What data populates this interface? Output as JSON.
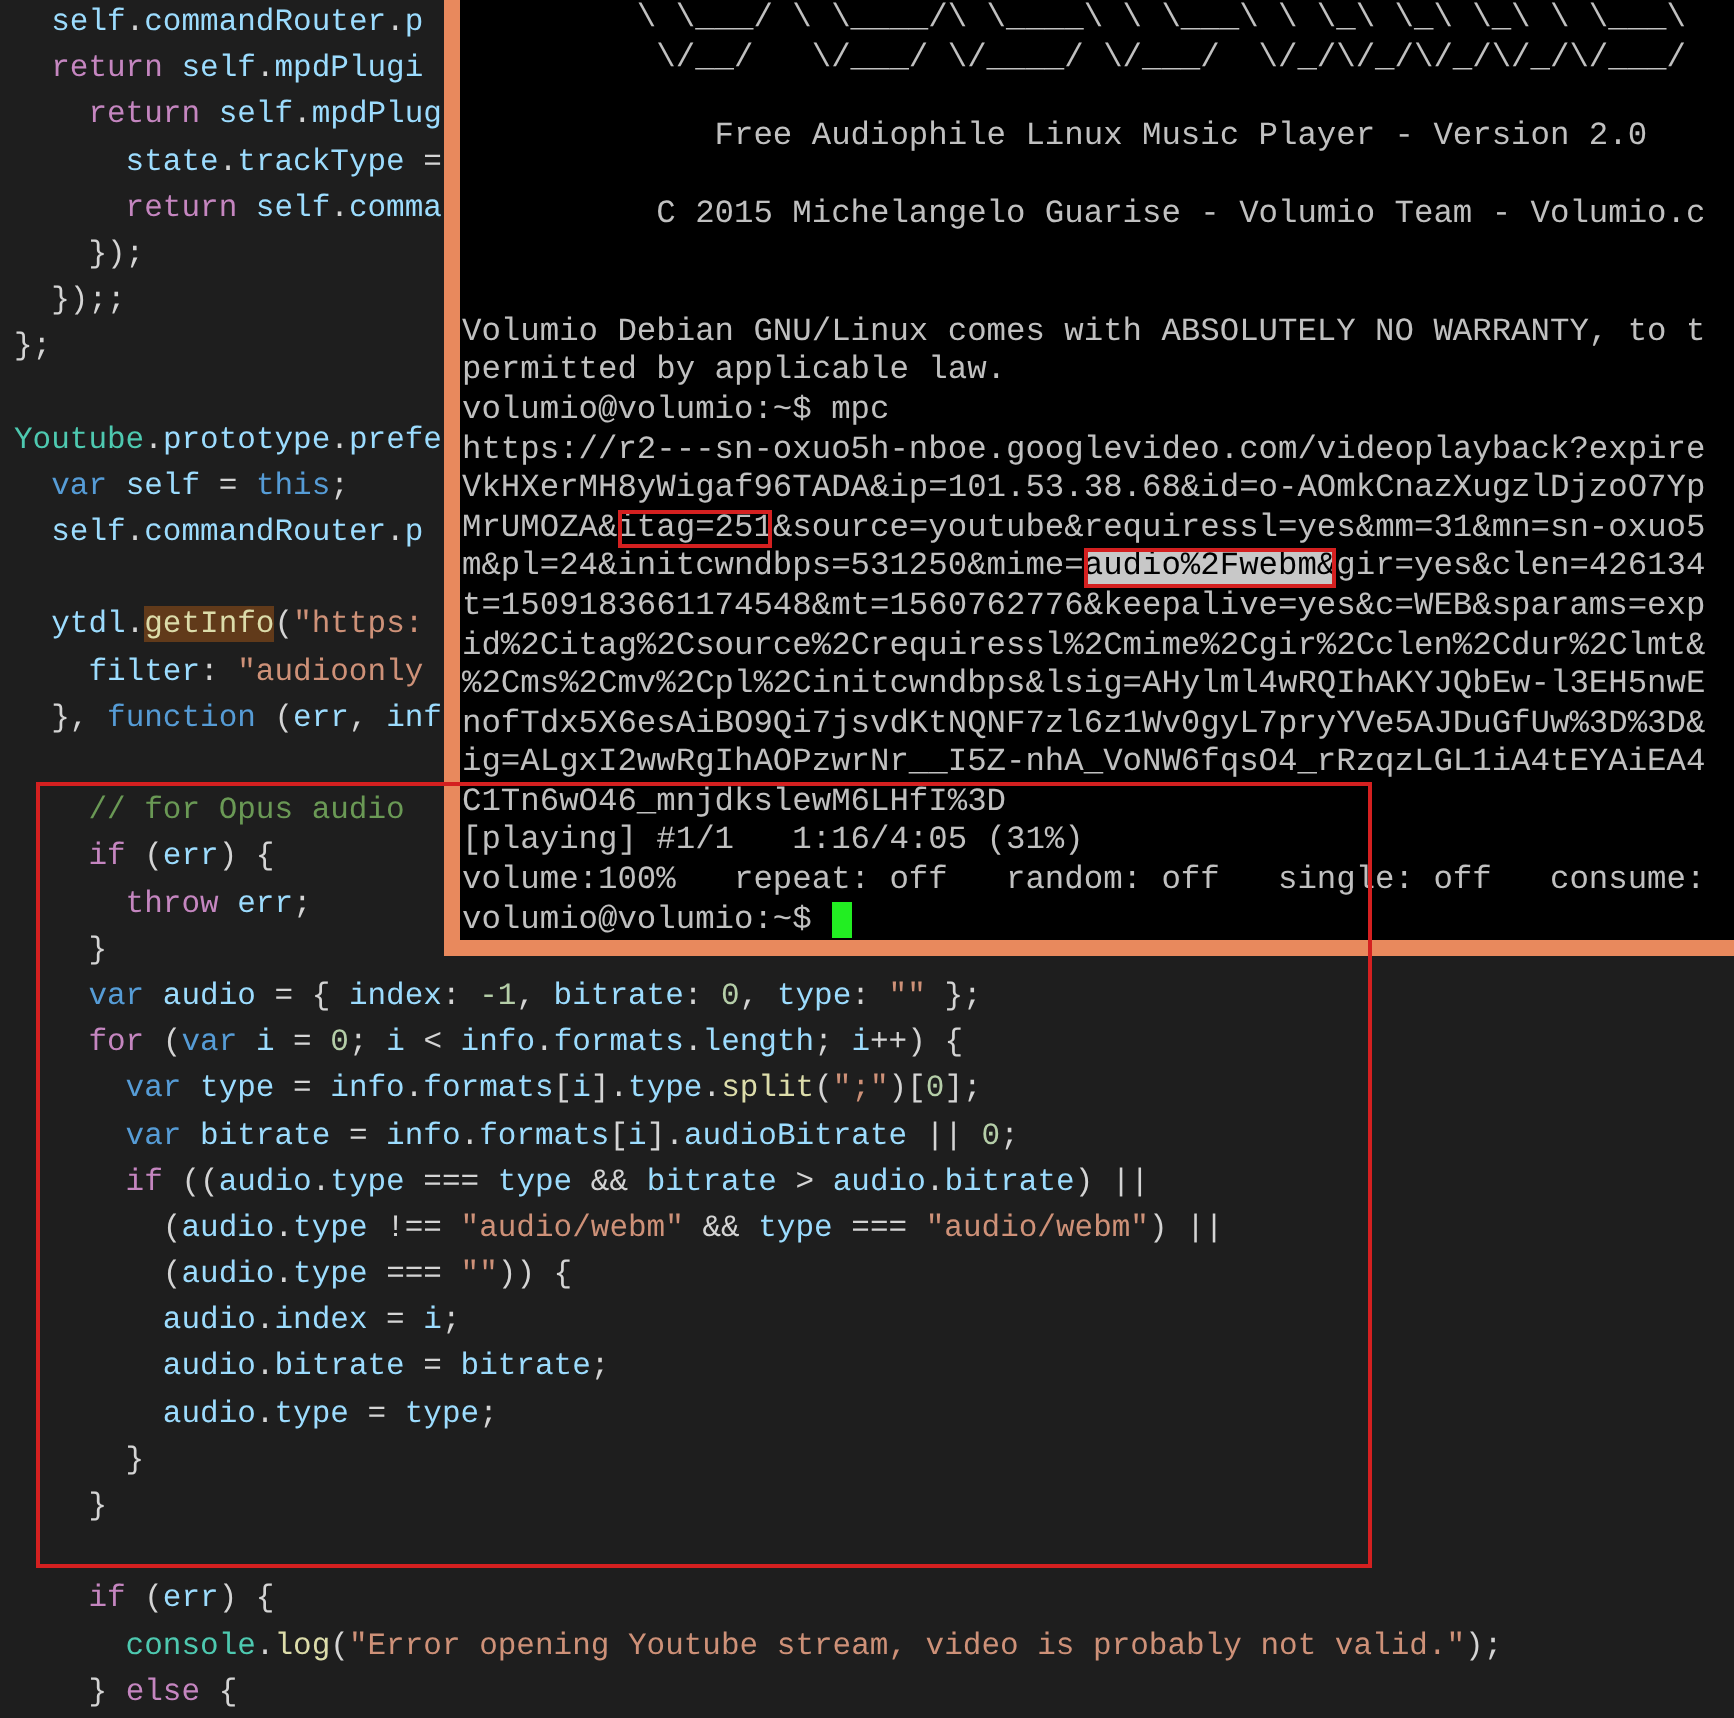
{
  "editor": {
    "lines": [
      {
        "kind": "code",
        "tokens": [
          {
            "kind": "variable",
            "text": "  self"
          },
          {
            "kind": "plain",
            "text": "."
          },
          {
            "kind": "variable",
            "text": "commandRouter"
          },
          {
            "kind": "plain",
            "text": "."
          },
          {
            "kind": "variable",
            "text": "p"
          }
        ]
      },
      {
        "kind": "code",
        "tokens": [
          {
            "kind": "keyword",
            "text": "  return"
          },
          {
            "kind": "variable",
            "text": " self"
          },
          {
            "kind": "plain",
            "text": "."
          },
          {
            "kind": "variable",
            "text": "mpdPlugi"
          }
        ]
      },
      {
        "kind": "code",
        "tokens": [
          {
            "kind": "keyword",
            "text": "    return"
          },
          {
            "kind": "variable",
            "text": " self"
          },
          {
            "kind": "plain",
            "text": "."
          },
          {
            "kind": "variable",
            "text": "mpdPlug"
          }
        ]
      },
      {
        "kind": "code",
        "tokens": [
          {
            "kind": "variable",
            "text": "      state"
          },
          {
            "kind": "plain",
            "text": "."
          },
          {
            "kind": "variable",
            "text": "trackType"
          },
          {
            "kind": "plain",
            "text": " ="
          }
        ]
      },
      {
        "kind": "code",
        "tokens": [
          {
            "kind": "keyword",
            "text": "      return"
          },
          {
            "kind": "variable",
            "text": " self"
          },
          {
            "kind": "plain",
            "text": "."
          },
          {
            "kind": "variable",
            "text": "comma"
          }
        ]
      },
      {
        "kind": "code",
        "tokens": [
          {
            "kind": "plain",
            "text": "    });"
          }
        ]
      },
      {
        "kind": "code",
        "tokens": [
          {
            "kind": "plain",
            "text": "  });;"
          }
        ]
      },
      {
        "kind": "code",
        "tokens": [
          {
            "kind": "plain",
            "text": "};"
          }
        ]
      },
      {
        "kind": "blank"
      },
      {
        "kind": "code",
        "tokens": [
          {
            "kind": "type",
            "text": "Youtube"
          },
          {
            "kind": "plain",
            "text": "."
          },
          {
            "kind": "variable",
            "text": "prototype"
          },
          {
            "kind": "plain",
            "text": "."
          },
          {
            "kind": "variable",
            "text": "prefe"
          }
        ]
      },
      {
        "kind": "code",
        "tokens": [
          {
            "kind": "storage",
            "text": "  var"
          },
          {
            "kind": "variable",
            "text": " self"
          },
          {
            "kind": "plain",
            "text": " = "
          },
          {
            "kind": "storage",
            "text": "this"
          },
          {
            "kind": "plain",
            "text": ";"
          }
        ]
      },
      {
        "kind": "code",
        "tokens": [
          {
            "kind": "variable",
            "text": "  self"
          },
          {
            "kind": "plain",
            "text": "."
          },
          {
            "kind": "variable",
            "text": "commandRouter"
          },
          {
            "kind": "plain",
            "text": "."
          },
          {
            "kind": "variable",
            "text": "p"
          }
        ]
      },
      {
        "kind": "blank"
      },
      {
        "kind": "code",
        "tokens": [
          {
            "kind": "variable",
            "text": "  ytdl"
          },
          {
            "kind": "plain",
            "text": "."
          },
          {
            "kind": "match",
            "text": "getInfo"
          },
          {
            "kind": "plain",
            "text": "("
          },
          {
            "kind": "string",
            "text": "\"https:"
          }
        ]
      },
      {
        "kind": "code",
        "tokens": [
          {
            "kind": "variable",
            "text": "    filter"
          },
          {
            "kind": "plain",
            "text": ": "
          },
          {
            "kind": "string",
            "text": "\"audioonly"
          }
        ]
      },
      {
        "kind": "code",
        "tokens": [
          {
            "kind": "plain",
            "text": "  }, "
          },
          {
            "kind": "storage",
            "text": "function"
          },
          {
            "kind": "plain",
            "text": " ("
          },
          {
            "kind": "variable",
            "text": "err"
          },
          {
            "kind": "plain",
            "text": ", "
          },
          {
            "kind": "variable",
            "text": "inf"
          }
        ]
      },
      {
        "kind": "blank"
      },
      {
        "kind": "code",
        "tokens": [
          {
            "kind": "comment",
            "text": "    // for Opus audio"
          }
        ]
      },
      {
        "kind": "code",
        "tokens": [
          {
            "kind": "keyword",
            "text": "    if"
          },
          {
            "kind": "plain",
            "text": " ("
          },
          {
            "kind": "variable",
            "text": "err"
          },
          {
            "kind": "plain",
            "text": ") {"
          }
        ]
      },
      {
        "kind": "code",
        "tokens": [
          {
            "kind": "keyword",
            "text": "      throw"
          },
          {
            "kind": "variable",
            "text": " err"
          },
          {
            "kind": "plain",
            "text": ";"
          }
        ]
      },
      {
        "kind": "code",
        "tokens": [
          {
            "kind": "plain",
            "text": "    }"
          }
        ]
      },
      {
        "kind": "code",
        "tokens": [
          {
            "kind": "storage",
            "text": "    var"
          },
          {
            "kind": "variable",
            "text": " audio"
          },
          {
            "kind": "plain",
            "text": " = { "
          },
          {
            "kind": "variable",
            "text": "index"
          },
          {
            "kind": "plain",
            "text": ": "
          },
          {
            "kind": "number",
            "text": "-1"
          },
          {
            "kind": "plain",
            "text": ", "
          },
          {
            "kind": "variable",
            "text": "bitrate"
          },
          {
            "kind": "plain",
            "text": ": "
          },
          {
            "kind": "number",
            "text": "0"
          },
          {
            "kind": "plain",
            "text": ", "
          },
          {
            "kind": "variable",
            "text": "type"
          },
          {
            "kind": "plain",
            "text": ": "
          },
          {
            "kind": "string",
            "text": "\"\""
          },
          {
            "kind": "plain",
            "text": " };"
          }
        ]
      },
      {
        "kind": "code",
        "tokens": [
          {
            "kind": "keyword",
            "text": "    for"
          },
          {
            "kind": "plain",
            "text": " ("
          },
          {
            "kind": "storage",
            "text": "var"
          },
          {
            "kind": "variable",
            "text": " i"
          },
          {
            "kind": "plain",
            "text": " = "
          },
          {
            "kind": "number",
            "text": "0"
          },
          {
            "kind": "plain",
            "text": "; "
          },
          {
            "kind": "variable",
            "text": "i"
          },
          {
            "kind": "plain",
            "text": " < "
          },
          {
            "kind": "variable",
            "text": "info"
          },
          {
            "kind": "plain",
            "text": "."
          },
          {
            "kind": "variable",
            "text": "formats"
          },
          {
            "kind": "plain",
            "text": "."
          },
          {
            "kind": "variable",
            "text": "length"
          },
          {
            "kind": "plain",
            "text": "; "
          },
          {
            "kind": "variable",
            "text": "i"
          },
          {
            "kind": "plain",
            "text": "++) {"
          }
        ]
      },
      {
        "kind": "code",
        "tokens": [
          {
            "kind": "storage",
            "text": "      var"
          },
          {
            "kind": "variable",
            "text": " type"
          },
          {
            "kind": "plain",
            "text": " = "
          },
          {
            "kind": "variable",
            "text": "info"
          },
          {
            "kind": "plain",
            "text": "."
          },
          {
            "kind": "variable",
            "text": "formats"
          },
          {
            "kind": "plain",
            "text": "["
          },
          {
            "kind": "variable",
            "text": "i"
          },
          {
            "kind": "plain",
            "text": "]."
          },
          {
            "kind": "variable",
            "text": "type"
          },
          {
            "kind": "plain",
            "text": "."
          },
          {
            "kind": "function",
            "text": "split"
          },
          {
            "kind": "plain",
            "text": "("
          },
          {
            "kind": "string",
            "text": "\";\""
          },
          {
            "kind": "plain",
            "text": ")["
          },
          {
            "kind": "number",
            "text": "0"
          },
          {
            "kind": "plain",
            "text": "];"
          }
        ]
      },
      {
        "kind": "code",
        "tokens": [
          {
            "kind": "storage",
            "text": "      var"
          },
          {
            "kind": "variable",
            "text": " bitrate"
          },
          {
            "kind": "plain",
            "text": " = "
          },
          {
            "kind": "variable",
            "text": "info"
          },
          {
            "kind": "plain",
            "text": "."
          },
          {
            "kind": "variable",
            "text": "formats"
          },
          {
            "kind": "plain",
            "text": "["
          },
          {
            "kind": "variable",
            "text": "i"
          },
          {
            "kind": "plain",
            "text": "]."
          },
          {
            "kind": "variable",
            "text": "audioBitrate"
          },
          {
            "kind": "plain",
            "text": " || "
          },
          {
            "kind": "number",
            "text": "0"
          },
          {
            "kind": "plain",
            "text": ";"
          }
        ]
      },
      {
        "kind": "code",
        "tokens": [
          {
            "kind": "keyword",
            "text": "      if"
          },
          {
            "kind": "plain",
            "text": " (("
          },
          {
            "kind": "variable",
            "text": "audio"
          },
          {
            "kind": "plain",
            "text": "."
          },
          {
            "kind": "variable",
            "text": "type"
          },
          {
            "kind": "plain",
            "text": " === "
          },
          {
            "kind": "variable",
            "text": "type"
          },
          {
            "kind": "plain",
            "text": " && "
          },
          {
            "kind": "variable",
            "text": "bitrate"
          },
          {
            "kind": "plain",
            "text": " > "
          },
          {
            "kind": "variable",
            "text": "audio"
          },
          {
            "kind": "plain",
            "text": "."
          },
          {
            "kind": "variable",
            "text": "bitrate"
          },
          {
            "kind": "plain",
            "text": ") ||"
          }
        ]
      },
      {
        "kind": "code",
        "tokens": [
          {
            "kind": "plain",
            "text": "        ("
          },
          {
            "kind": "variable",
            "text": "audio"
          },
          {
            "kind": "plain",
            "text": "."
          },
          {
            "kind": "variable",
            "text": "type"
          },
          {
            "kind": "plain",
            "text": " !== "
          },
          {
            "kind": "string",
            "text": "\"audio/webm\""
          },
          {
            "kind": "plain",
            "text": " && "
          },
          {
            "kind": "variable",
            "text": "type"
          },
          {
            "kind": "plain",
            "text": " === "
          },
          {
            "kind": "string",
            "text": "\"audio/webm\""
          },
          {
            "kind": "plain",
            "text": ") ||"
          }
        ]
      },
      {
        "kind": "code",
        "tokens": [
          {
            "kind": "plain",
            "text": "        ("
          },
          {
            "kind": "variable",
            "text": "audio"
          },
          {
            "kind": "plain",
            "text": "."
          },
          {
            "kind": "variable",
            "text": "type"
          },
          {
            "kind": "plain",
            "text": " === "
          },
          {
            "kind": "string",
            "text": "\"\""
          },
          {
            "kind": "plain",
            "text": ")) {"
          }
        ]
      },
      {
        "kind": "code",
        "tokens": [
          {
            "kind": "variable",
            "text": "        audio"
          },
          {
            "kind": "plain",
            "text": "."
          },
          {
            "kind": "variable",
            "text": "index"
          },
          {
            "kind": "plain",
            "text": " = "
          },
          {
            "kind": "variable",
            "text": "i"
          },
          {
            "kind": "plain",
            "text": ";"
          }
        ]
      },
      {
        "kind": "code",
        "tokens": [
          {
            "kind": "variable",
            "text": "        audio"
          },
          {
            "kind": "plain",
            "text": "."
          },
          {
            "kind": "variable",
            "text": "bitrate"
          },
          {
            "kind": "plain",
            "text": " = "
          },
          {
            "kind": "variable",
            "text": "bitrate"
          },
          {
            "kind": "plain",
            "text": ";"
          }
        ]
      },
      {
        "kind": "code",
        "tokens": [
          {
            "kind": "variable",
            "text": "        audio"
          },
          {
            "kind": "plain",
            "text": "."
          },
          {
            "kind": "variable",
            "text": "type"
          },
          {
            "kind": "plain",
            "text": " = "
          },
          {
            "kind": "variable",
            "text": "type"
          },
          {
            "kind": "plain",
            "text": ";"
          }
        ]
      },
      {
        "kind": "code",
        "tokens": [
          {
            "kind": "plain",
            "text": "      }"
          }
        ]
      },
      {
        "kind": "code",
        "tokens": [
          {
            "kind": "plain",
            "text": "    }"
          }
        ]
      },
      {
        "kind": "blank"
      },
      {
        "kind": "code",
        "tokens": [
          {
            "kind": "keyword",
            "text": "    if"
          },
          {
            "kind": "plain",
            "text": " ("
          },
          {
            "kind": "variable",
            "text": "err"
          },
          {
            "kind": "plain",
            "text": ") {"
          }
        ]
      },
      {
        "kind": "code",
        "tokens": [
          {
            "kind": "type",
            "text": "      console"
          },
          {
            "kind": "plain",
            "text": "."
          },
          {
            "kind": "function",
            "text": "log"
          },
          {
            "kind": "plain",
            "text": "("
          },
          {
            "kind": "string",
            "text": "\"Error opening Youtube stream, video is probably not valid.\""
          },
          {
            "kind": "plain",
            "text": ");"
          }
        ]
      },
      {
        "kind": "code",
        "tokens": [
          {
            "kind": "plain",
            "text": "    } "
          },
          {
            "kind": "keyword",
            "text": "else"
          },
          {
            "kind": "plain",
            "text": " {"
          }
        ]
      }
    ]
  },
  "terminal": {
    "lines": [
      {
        "kind": "text",
        "text": "         \\ \\___/ \\ \\____/\\ \\____\\ \\ \\___\\ \\ \\_\\ \\_\\ \\_\\ \\ \\___\\"
      },
      {
        "kind": "text",
        "text": "          \\/__/   \\/___/ \\/____/ \\/___/  \\/_/\\/_/\\/_/\\/_/\\/___/"
      },
      {
        "kind": "blank"
      },
      {
        "kind": "text",
        "text": "             Free Audiophile Linux Music Player - Version 2.0"
      },
      {
        "kind": "blank"
      },
      {
        "kind": "text",
        "text": "          C 2015 Michelangelo Guarise - Volumio Team - Volumio.c"
      },
      {
        "kind": "blank"
      },
      {
        "kind": "blank"
      },
      {
        "kind": "text",
        "text": "Volumio Debian GNU/Linux comes with ABSOLUTELY NO WARRANTY, to t"
      },
      {
        "kind": "text",
        "text": "permitted by applicable law."
      },
      {
        "kind": "text",
        "text": "volumio@volumio:~$ mpc"
      },
      {
        "kind": "text",
        "text": "https://r2---sn-oxuo5h-nboe.googlevideo.com/videoplayback?expire"
      },
      {
        "kind": "text",
        "text": "VkHXerMH8yWigaf96TADA&ip=101.53.38.68&id=o-AOmkCnazXugzlDjzoO7Yp"
      },
      {
        "kind": "segments",
        "segments": [
          {
            "text": "MrUMOZA&",
            "kind": "plain"
          },
          {
            "text": "itag=251",
            "kind": "boxed"
          },
          {
            "text": "&source=youtube&requiressl=yes&mm=31&mn=sn-oxuo5",
            "kind": "plain"
          }
        ]
      },
      {
        "kind": "segments",
        "segments": [
          {
            "text": "m&pl=24&initcwndbps=531250&mime=",
            "kind": "plain"
          },
          {
            "text": "audio%2Fwebm&",
            "kind": "selected"
          },
          {
            "text": "gir=yes&clen=426134",
            "kind": "plain"
          }
        ]
      },
      {
        "kind": "text",
        "text": "t=1509183661174548&mt=1560762776&keepalive=yes&c=WEB&sparams=exp"
      },
      {
        "kind": "text",
        "text": "id%2Citag%2Csource%2Crequiressl%2Cmime%2Cgir%2Cclen%2Cdur%2Clmt&"
      },
      {
        "kind": "text",
        "text": "%2Cms%2Cmv%2Cpl%2Cinitcwndbps&lsig=AHylml4wRQIhAKYJQbEw-l3EH5nwE"
      },
      {
        "kind": "text",
        "text": "nofTdx5X6esAiBO9Qi7jsvdKtNQNF7zl6z1Wv0gyL7pryYVe5AJDuGfUw%3D%3D&"
      },
      {
        "kind": "text",
        "text": "ig=ALgxI2wwRgIhAOPzwrNr__I5Z-nhA_VoNW6fqsO4_rRzqzLGL1iA4tEYAiEA4"
      },
      {
        "kind": "text",
        "text": "C1Tn6wO46_mnjdkslewM6LHfI%3D"
      },
      {
        "kind": "text",
        "text": "[playing] #1/1   1:16/4:05 (31%)"
      },
      {
        "kind": "text",
        "text": "volume:100%   repeat: off   random: off   single: off   consume:"
      },
      {
        "kind": "prompt",
        "text": "volumio@volumio:~$",
        "cursor": true
      }
    ]
  }
}
